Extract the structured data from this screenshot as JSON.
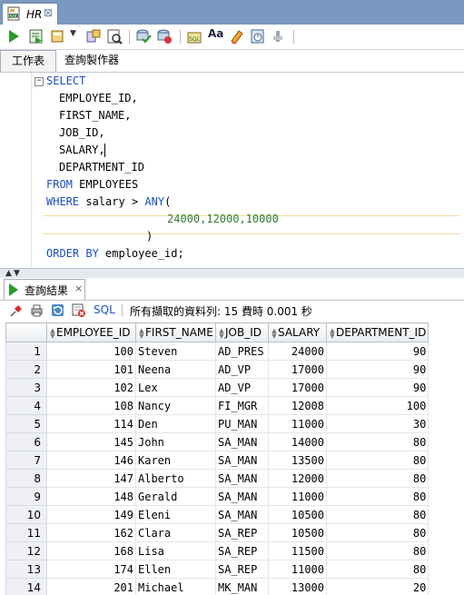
{
  "file_tab": {
    "title": "HR",
    "icon": "sql-file-icon"
  },
  "toolbar": {
    "icons": [
      "run-statement-icon",
      "run-script-icon",
      "commit-icon",
      "explain-plan-icon",
      "autotrace-icon",
      "commit-transaction-icon",
      "rollback-icon",
      "unshared-sql-icon",
      "format-icon",
      "clear-icon",
      "sql-history-icon",
      "tuning-icon"
    ]
  },
  "editor_tabs": {
    "worksheet": "工作表",
    "query_builder": "查詢製作器"
  },
  "sql": {
    "select_kw": "SELECT",
    "columns": [
      "EMPLOYEE_ID,",
      "FIRST_NAME,",
      "JOB_ID,",
      "SALARY,",
      "DEPARTMENT_ID"
    ],
    "from_kw": "FROM",
    "table": "EMPLOYEES",
    "where_kw": "WHERE",
    "where_col": "salary",
    "op": ">",
    "any_kw": "ANY",
    "open_paren": "(",
    "values": "24000,12000,10000",
    "close_paren": ")",
    "order_kw": "ORDER BY",
    "order_col": "employee_id;"
  },
  "result_tab": {
    "label": "查詢結果",
    "close": "×"
  },
  "result_toolbar": {
    "sql_label": "SQL",
    "status": "所有擷取的資料列: 15 費時 0.001 秒"
  },
  "grid": {
    "columns": [
      "EMPLOYEE_ID",
      "FIRST_NAME",
      "JOB_ID",
      "SALARY",
      "DEPARTMENT_ID"
    ],
    "rows": [
      [
        "1",
        "100",
        "Steven",
        "AD_PRES",
        "24000",
        "90"
      ],
      [
        "2",
        "101",
        "Neena",
        "AD_VP",
        "17000",
        "90"
      ],
      [
        "3",
        "102",
        "Lex",
        "AD_VP",
        "17000",
        "90"
      ],
      [
        "4",
        "108",
        "Nancy",
        "FI_MGR",
        "12008",
        "100"
      ],
      [
        "5",
        "114",
        "Den",
        "PU_MAN",
        "11000",
        "30"
      ],
      [
        "6",
        "145",
        "John",
        "SA_MAN",
        "14000",
        "80"
      ],
      [
        "7",
        "146",
        "Karen",
        "SA_MAN",
        "13500",
        "80"
      ],
      [
        "8",
        "147",
        "Alberto",
        "SA_MAN",
        "12000",
        "80"
      ],
      [
        "9",
        "148",
        "Gerald",
        "SA_MAN",
        "11000",
        "80"
      ],
      [
        "10",
        "149",
        "Eleni",
        "SA_MAN",
        "10500",
        "80"
      ],
      [
        "11",
        "162",
        "Clara",
        "SA_REP",
        "10500",
        "80"
      ],
      [
        "12",
        "168",
        "Lisa",
        "SA_REP",
        "11500",
        "80"
      ],
      [
        "13",
        "174",
        "Ellen",
        "SA_REP",
        "11000",
        "80"
      ],
      [
        "14",
        "201",
        "Michael",
        "MK_MAN",
        "13000",
        "20"
      ]
    ]
  }
}
